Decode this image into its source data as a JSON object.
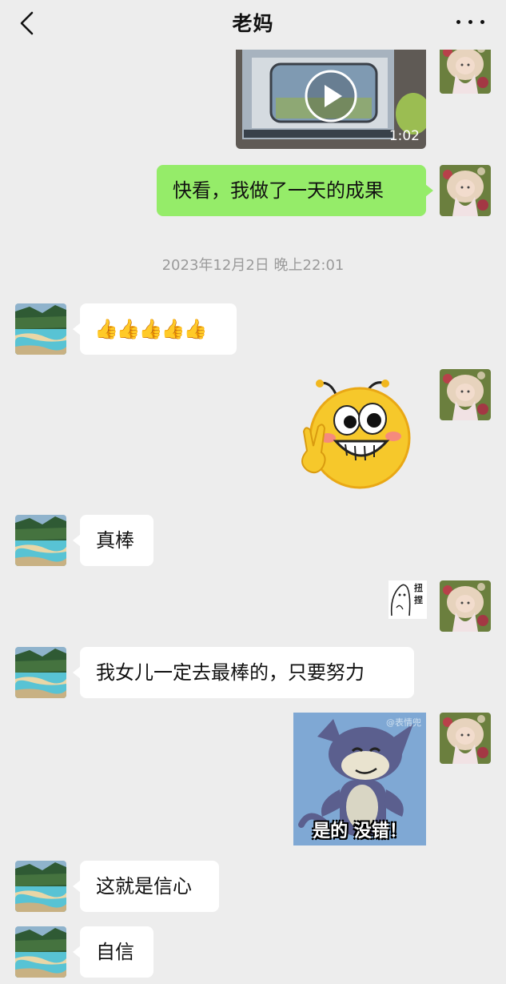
{
  "header": {
    "title": "老妈",
    "back_icon": "chevron-left-icon",
    "more_icon": "more-dots-icon"
  },
  "messages": [
    {
      "id": 1,
      "side": "right",
      "type": "video",
      "duration": "1:02"
    },
    {
      "id": 2,
      "side": "right",
      "type": "text",
      "text": "快看，我做了一天的成果"
    },
    {
      "id": 3,
      "type": "timestamp",
      "text": "2023年12月2日 晚上22:01"
    },
    {
      "id": 4,
      "side": "left",
      "type": "emoji",
      "text": "👍👍👍👍👍"
    },
    {
      "id": 5,
      "side": "right",
      "type": "sticker",
      "icon": "grinning-victory-emoji-sticker"
    },
    {
      "id": 6,
      "side": "left",
      "type": "text",
      "text": "真棒"
    },
    {
      "id": 7,
      "side": "right",
      "type": "sticker",
      "icon": "shy-cat-sketch-sticker",
      "text": "扭捏"
    },
    {
      "id": 8,
      "side": "left",
      "type": "text",
      "text": "我女儿一定去最棒的，只要努力"
    },
    {
      "id": 9,
      "side": "right",
      "type": "sticker",
      "icon": "tom-cat-sticker",
      "caption": "是的 没错！",
      "watermark": "@表情兜"
    },
    {
      "id": 10,
      "side": "left",
      "type": "text",
      "text": "这就是信心"
    },
    {
      "id": 11,
      "side": "left",
      "type": "text",
      "text": "自信"
    }
  ],
  "colors": {
    "background": "#ededed",
    "bubble_right": "#95ec69",
    "bubble_left": "#ffffff",
    "timestamp": "#9a9a9a"
  }
}
